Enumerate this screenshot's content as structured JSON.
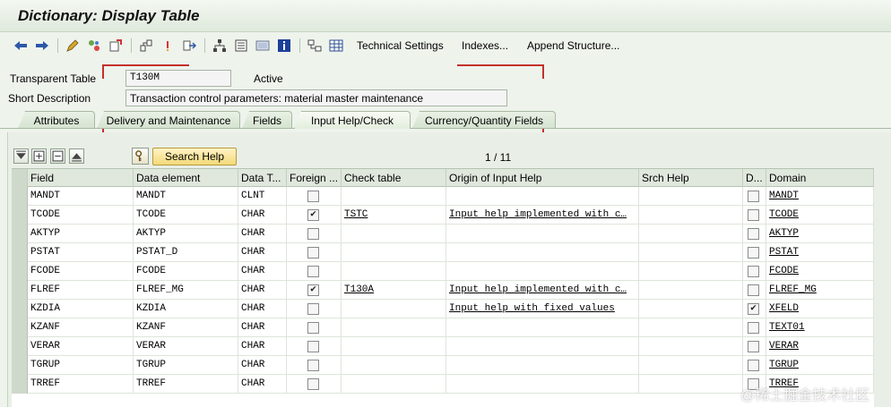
{
  "window": {
    "title": "Dictionary: Display Table"
  },
  "toolbar": {
    "icons": [
      "back-arrow-icon",
      "forward-arrow-icon",
      "other-object-icon",
      "display-change-icon",
      "activate-icon",
      "check-icon",
      "where-used-icon",
      "navigate-icon",
      "hierarchy-icon",
      "contents-icon",
      "graphic-icon",
      "info-icon",
      "entity-icon",
      "table-icon"
    ],
    "technical_settings": "Technical Settings",
    "indexes": "Indexes...",
    "append_structure": "Append Structure..."
  },
  "header": {
    "table_label": "Transparent Table",
    "table_value": "T130M",
    "status": "Active",
    "short_desc_label": "Short Description",
    "short_desc_value": "Transaction control parameters: material master maintenance"
  },
  "tabs": [
    "Attributes",
    "Delivery and Maintenance",
    "Fields",
    "Input Help/Check",
    "Currency/Quantity Fields"
  ],
  "active_tab": "Input Help/Check",
  "table_controls": {
    "search_help_button": "Search Help",
    "pager": "1 / 11"
  },
  "columns": [
    "Field",
    "Data element",
    "Data T...",
    "Foreign ...",
    "Check table",
    "Origin of Input Help",
    "Srch Help",
    "D...",
    "Domain"
  ],
  "rows": [
    {
      "field": "MANDT",
      "data_element": "MANDT",
      "data_type": "CLNT",
      "foreign": false,
      "check_table": "",
      "origin": "",
      "srch_help": "",
      "d": false,
      "domain": "MANDT"
    },
    {
      "field": "TCODE",
      "data_element": "TCODE",
      "data_type": "CHAR",
      "foreign": true,
      "check_table": "TSTC",
      "origin": "Input help implemented with c…",
      "srch_help": "",
      "d": false,
      "domain": "TCODE"
    },
    {
      "field": "AKTYP",
      "data_element": "AKTYP",
      "data_type": "CHAR",
      "foreign": false,
      "check_table": "",
      "origin": "",
      "srch_help": "",
      "d": false,
      "domain": "AKTYP"
    },
    {
      "field": "PSTAT",
      "data_element": "PSTAT_D",
      "data_type": "CHAR",
      "foreign": false,
      "check_table": "",
      "origin": "",
      "srch_help": "",
      "d": false,
      "domain": "PSTAT"
    },
    {
      "field": "FCODE",
      "data_element": "FCODE",
      "data_type": "CHAR",
      "foreign": false,
      "check_table": "",
      "origin": "",
      "srch_help": "",
      "d": false,
      "domain": "FCODE"
    },
    {
      "field": "FLREF",
      "data_element": "FLREF_MG",
      "data_type": "CHAR",
      "foreign": true,
      "check_table": "T130A",
      "origin": "Input help implemented with c…",
      "srch_help": "",
      "d": false,
      "domain": "FLREF_MG"
    },
    {
      "field": "KZDIA",
      "data_element": "KZDIA",
      "data_type": "CHAR",
      "foreign": false,
      "check_table": "",
      "origin": "Input help with fixed values",
      "srch_help": "",
      "d": true,
      "domain": "XFELD"
    },
    {
      "field": "KZANF",
      "data_element": "KZANF",
      "data_type": "CHAR",
      "foreign": false,
      "check_table": "",
      "origin": "",
      "srch_help": "",
      "d": false,
      "domain": "TEXT01"
    },
    {
      "field": "VERAR",
      "data_element": "VERAR",
      "data_type": "CHAR",
      "foreign": false,
      "check_table": "",
      "origin": "",
      "srch_help": "",
      "d": false,
      "domain": "VERAR"
    },
    {
      "field": "TGRUP",
      "data_element": "TGRUP",
      "data_type": "CHAR",
      "foreign": false,
      "check_table": "",
      "origin": "",
      "srch_help": "",
      "d": false,
      "domain": "TGRUP"
    },
    {
      "field": "TRREF",
      "data_element": "TRREF",
      "data_type": "CHAR",
      "foreign": false,
      "check_table": "",
      "origin": "",
      "srch_help": "",
      "d": false,
      "domain": "TRREF"
    }
  ],
  "watermark": "@稀土掘金技术社区",
  "colors": {
    "accent_red": "#c4302b",
    "search_button": "#f3d97a",
    "background": "#eef3ec"
  }
}
